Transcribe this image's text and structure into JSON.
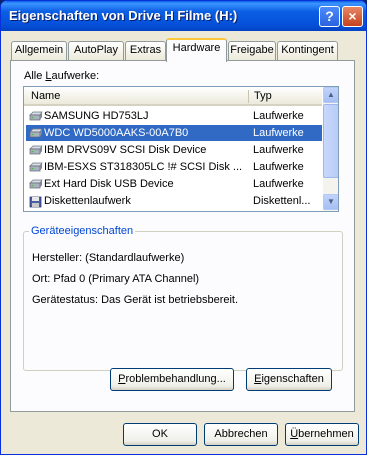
{
  "window": {
    "title": "Eigenschaften von Drive H Filme (H:)",
    "help_label": "?",
    "close_label": "×"
  },
  "tabs": [
    "Allgemein",
    "AutoPlay",
    "Extras",
    "Hardware",
    "Freigabe",
    "Kontingent"
  ],
  "active_tab": "Hardware",
  "drives_label": {
    "pre": "Alle ",
    "key": "L",
    "post": "aufwerke:"
  },
  "columns": {
    "name": "Name",
    "type": "Typ"
  },
  "drives": [
    {
      "name": "SAMSUNG HD753LJ",
      "type": "Laufwerke",
      "icon": "hard-drive-icon",
      "selected": false
    },
    {
      "name": "WDC WD5000AAKS-00A7B0",
      "type": "Laufwerke",
      "icon": "hard-drive-icon",
      "selected": true
    },
    {
      "name": "IBM DRVS09V SCSI Disk Device",
      "type": "Laufwerke",
      "icon": "hard-drive-icon",
      "selected": false
    },
    {
      "name": "IBM-ESXS ST318305LC     !# SCSI Disk ...",
      "type": "Laufwerke",
      "icon": "hard-drive-icon",
      "selected": false
    },
    {
      "name": "Ext Hard  Disk USB Device",
      "type": "Laufwerke",
      "icon": "hard-drive-icon",
      "selected": false
    },
    {
      "name": "Diskettenlaufwerk",
      "type": "Diskettenl...",
      "icon": "floppy-drive-icon",
      "selected": false
    }
  ],
  "properties": {
    "group_title": "Geräteeigenschaften",
    "manufacturer": "Hersteller: (Standardlaufwerke)",
    "location": "Ort: Pfad 0 (Primary ATA Channel)",
    "status": "Gerätestatus: Das Gerät ist betriebsbereit."
  },
  "buttons": {
    "troubleshoot": {
      "key": "P",
      "rest": "roblembehandlung..."
    },
    "properties": {
      "key": "E",
      "rest": "igenschaften"
    },
    "ok": "OK",
    "cancel": "Abbrechen",
    "apply": {
      "key": "Ü",
      "rest": "bernehmen"
    }
  },
  "colors": {
    "selection": "#316ac5",
    "group_title": "#0046d5",
    "titlebar": "#0550d9"
  }
}
